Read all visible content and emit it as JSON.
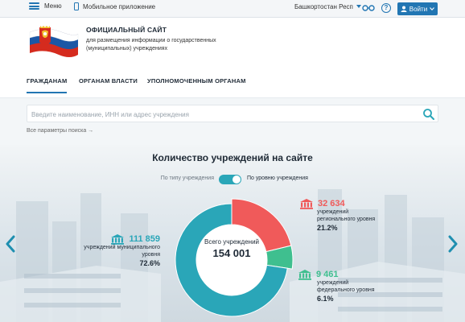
{
  "topbar": {
    "menu_label": "Меню",
    "mobile_label": "Мобильное приложение",
    "region": "Башкортостан Респ",
    "help_symbol": "?",
    "login_label": "Войти",
    "icons": [
      "menu-icon",
      "phone-icon",
      "glasses-icon",
      "help-icon",
      "user-icon",
      "chevron-down-icon"
    ]
  },
  "header": {
    "title": "ОФИЦИАЛЬНЫЙ САЙТ",
    "subtitle": "для размещения информации о государственных (муниципальных) учреждениях"
  },
  "nav": {
    "items": [
      {
        "label": "ГРАЖДАНАМ",
        "active": true
      },
      {
        "label": "ОРГАНАМ ВЛАСТИ",
        "active": false
      },
      {
        "label": "УПОЛНОМОЧЕННЫМ ОРГАНАМ",
        "active": false
      }
    ]
  },
  "search": {
    "placeholder": "Введите наименование, ИНН или адрес учреждения",
    "value": "",
    "all_params": "Все параметры поиска →"
  },
  "stats": {
    "title": "Количество учреждений на сайте",
    "toggle": {
      "left": "По типу учреждения",
      "right": "По уровню учреждения",
      "selected": "right"
    },
    "total_label": "Всего учреждений",
    "total": "154 001",
    "colors": {
      "municipal": "#2aa6b8",
      "regional": "#f05a5a",
      "federal": "#3fbf8f",
      "arrow": "#1f8fb0"
    },
    "segments": [
      {
        "key": "municipal",
        "value": "111 859",
        "label": "учреждений муниципального уровня",
        "percent": "72.6%",
        "fraction": 0.726
      },
      {
        "key": "regional",
        "value": "32 634",
        "label": "учреждений регионального уровня",
        "percent": "21.2%",
        "fraction": 0.212
      },
      {
        "key": "federal",
        "value": "9 461",
        "label": "учреждений федерального уровня",
        "percent": "6.1%",
        "fraction": 0.061
      }
    ]
  }
}
